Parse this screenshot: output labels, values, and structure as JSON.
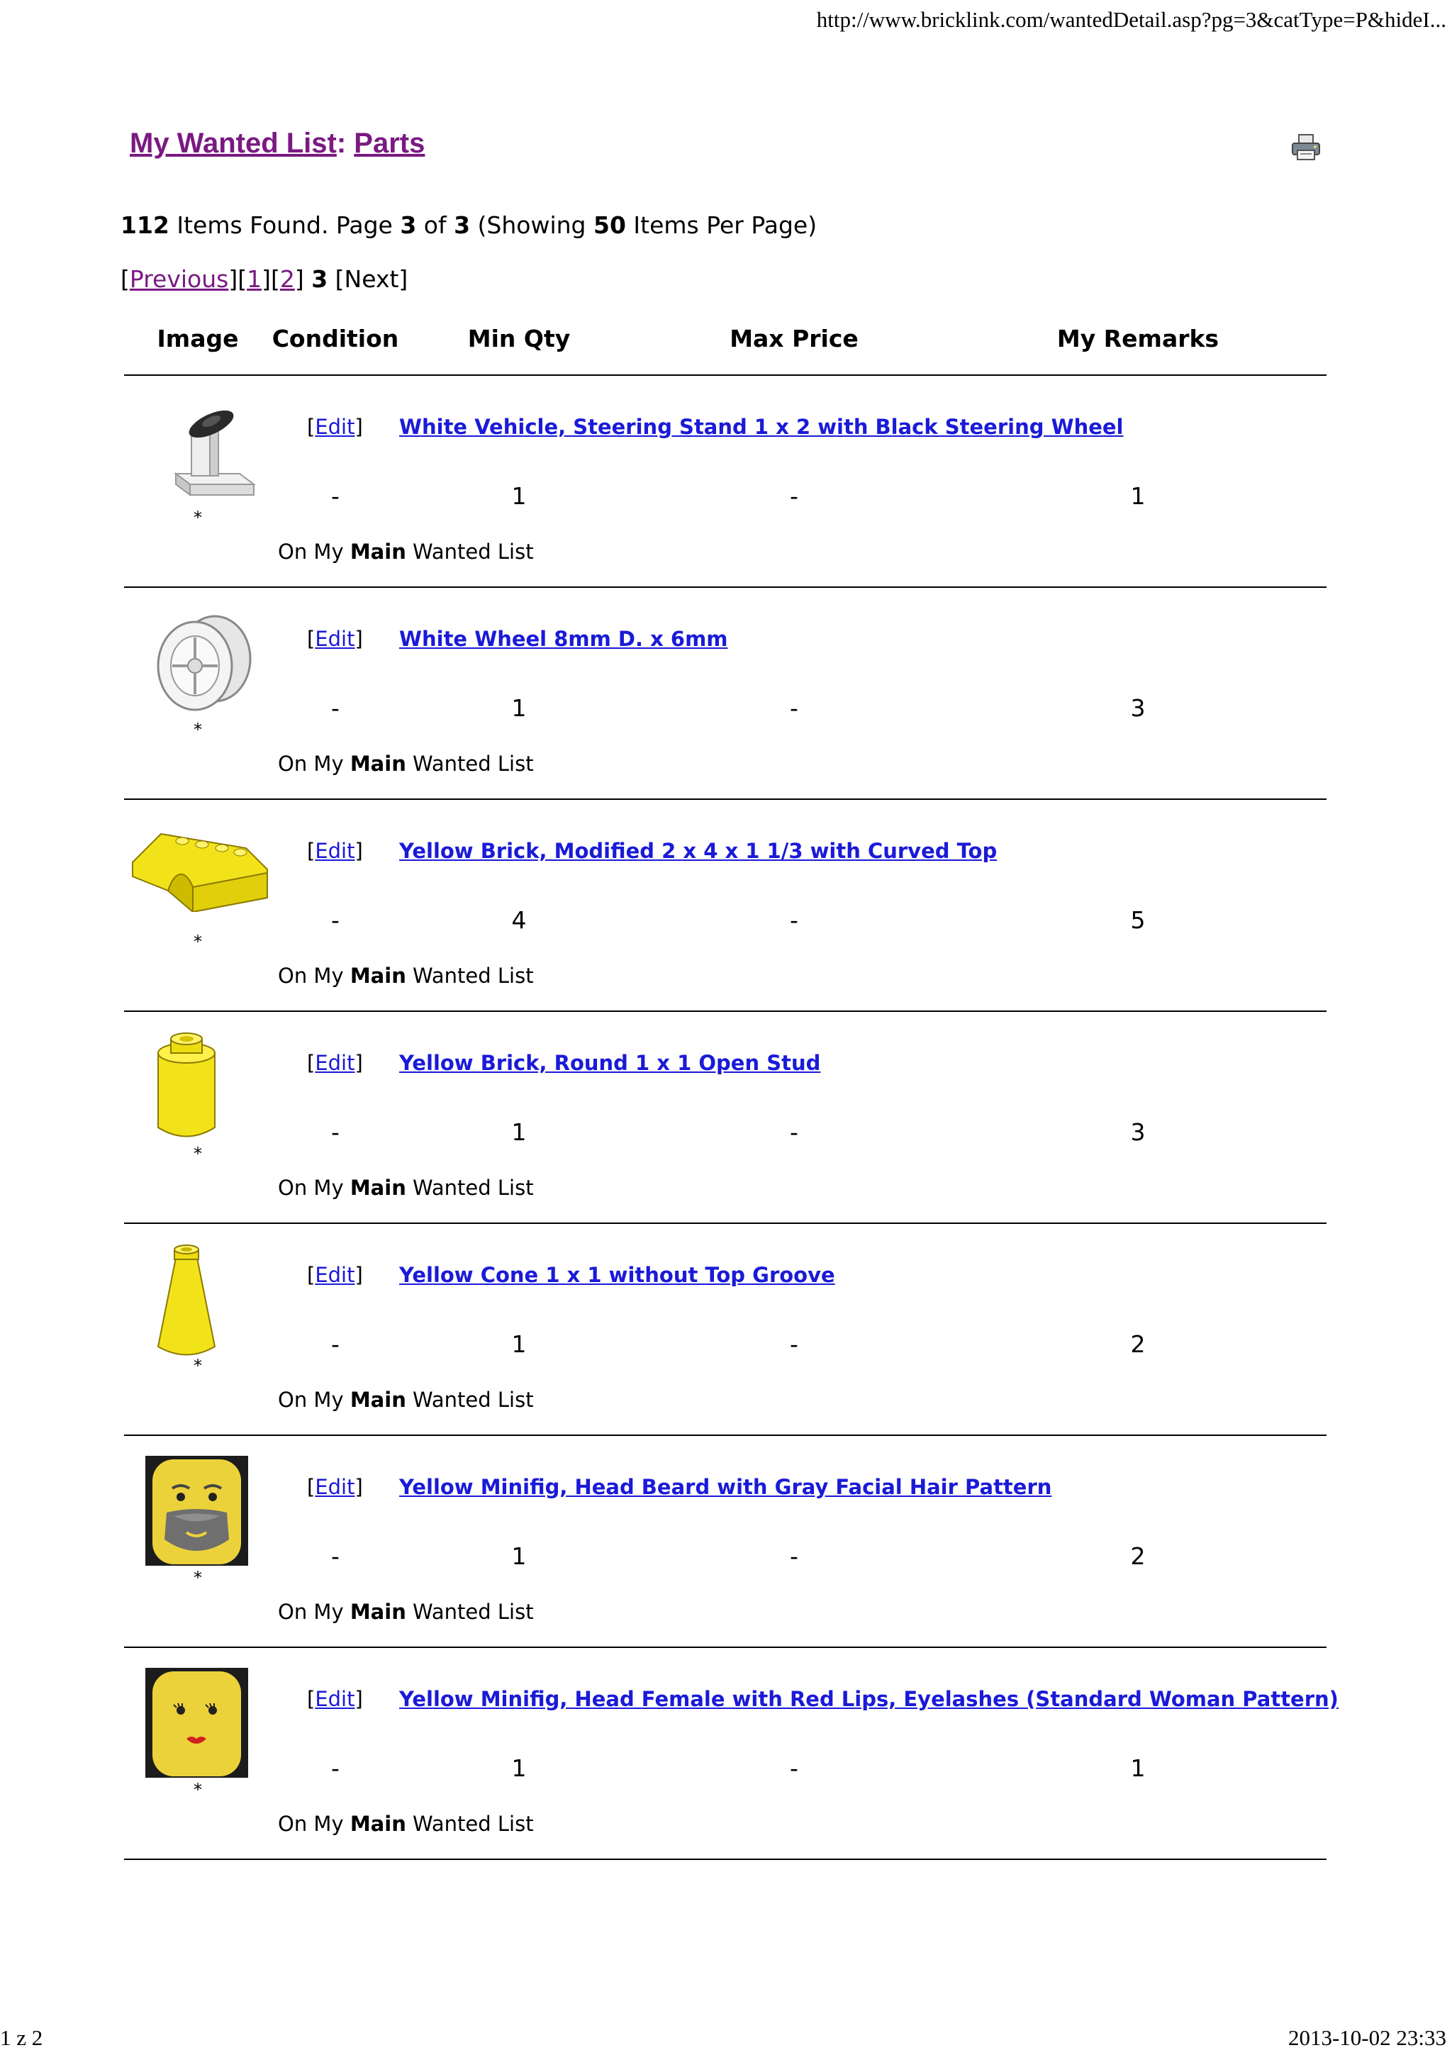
{
  "print_header": {
    "url": "http://www.bricklink.com/wantedDetail.asp?pg=3&catType=P&hideI..."
  },
  "title": {
    "part1": "My Wanted List",
    "sep": ": ",
    "part2": "Parts"
  },
  "summary": {
    "count": "112",
    "t1": " Items Found. Page ",
    "page": "3",
    "t2": " of ",
    "pages": "3",
    "t3": " (Showing ",
    "per_page": "50",
    "t4": " Items Per Page)"
  },
  "pager": {
    "lb": "[",
    "previous": "Previous",
    "mid1": "][",
    "p1": "1",
    "mid2": "][",
    "p2": "2",
    "rb": "] ",
    "current": "3",
    "next": " [Next]"
  },
  "columns": [
    "Image",
    "Condition",
    "Min Qty",
    "Max Price",
    "My Remarks"
  ],
  "items": [
    {
      "edit": "Edit",
      "name": "White Vehicle, Steering Stand 1 x 2 with Black Steering Wheel",
      "condition": "-",
      "min_qty": "1",
      "max_price": "-",
      "remarks": "1",
      "star": "*",
      "list_prefix": "On My ",
      "list_name": "Main",
      "list_suffix": " Wanted List",
      "icon": "steering-stand-icon"
    },
    {
      "edit": "Edit",
      "name": "White Wheel 8mm D. x 6mm",
      "condition": "-",
      "min_qty": "1",
      "max_price": "-",
      "remarks": "3",
      "star": "*",
      "list_prefix": "On My ",
      "list_name": "Main",
      "list_suffix": " Wanted List",
      "icon": "wheel-icon"
    },
    {
      "edit": "Edit",
      "name": "Yellow Brick, Modified 2 x 4 x 1 1/3 with Curved Top",
      "condition": "-",
      "min_qty": "4",
      "max_price": "-",
      "remarks": "5",
      "star": "*",
      "list_prefix": "On My ",
      "list_name": "Main",
      "list_suffix": " Wanted List",
      "icon": "curved-brick-icon"
    },
    {
      "edit": "Edit",
      "name": "Yellow Brick, Round 1 x 1 Open Stud",
      "condition": "-",
      "min_qty": "1",
      "max_price": "-",
      "remarks": "3",
      "star": "*",
      "list_prefix": "On My ",
      "list_name": "Main",
      "list_suffix": " Wanted List",
      "icon": "round-brick-icon"
    },
    {
      "edit": "Edit",
      "name": "Yellow Cone 1 x 1 without Top Groove",
      "condition": "-",
      "min_qty": "1",
      "max_price": "-",
      "remarks": "2",
      "star": "*",
      "list_prefix": "On My ",
      "list_name": "Main",
      "list_suffix": " Wanted List",
      "icon": "cone-icon"
    },
    {
      "edit": "Edit",
      "name": "Yellow Minifig, Head Beard with Gray Facial Hair Pattern",
      "condition": "-",
      "min_qty": "1",
      "max_price": "-",
      "remarks": "2",
      "star": "*",
      "list_prefix": "On My ",
      "list_name": "Main",
      "list_suffix": " Wanted List",
      "icon": "bearded-head-icon"
    },
    {
      "edit": "Edit",
      "name": "Yellow Minifig, Head Female with Red Lips, Eyelashes (Standard Woman Pattern)",
      "condition": "-",
      "min_qty": "1",
      "max_price": "-",
      "remarks": "1",
      "star": "*",
      "list_prefix": "On My ",
      "list_name": "Main",
      "list_suffix": " Wanted List",
      "icon": "female-head-icon"
    }
  ],
  "footer": {
    "page_of": "1 z 2",
    "datetime": "2013-10-02 23:33"
  }
}
